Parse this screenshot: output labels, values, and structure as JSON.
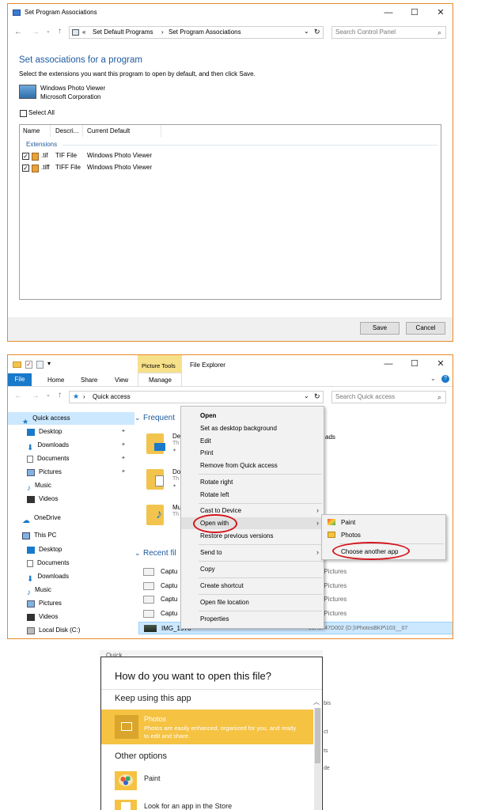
{
  "win1": {
    "title": "Set Program Associations",
    "breadcrumb_prefix": "«",
    "breadcrumb_1": "Set Default Programs",
    "breadcrumb_sep": "›",
    "breadcrumb_2": "Set Program Associations",
    "search_placeholder": "Search Control Panel",
    "heading": "Set associations for a program",
    "subtitle": "Select the extensions you want this program to open by default, and then click Save.",
    "program_name": "Windows Photo Viewer",
    "program_company": "Microsoft Corporation",
    "select_all": "Select All",
    "columns": [
      "Name",
      "Descri...",
      "Current Default"
    ],
    "group_label": "Extensions",
    "rows": [
      {
        "name": ".tif",
        "desc": "TIF File",
        "default": "Windows Photo Viewer"
      },
      {
        "name": ".tiff",
        "desc": "TIFF File",
        "default": "Windows Photo Viewer"
      }
    ],
    "save": "Save",
    "cancel": "Cancel"
  },
  "win2": {
    "picture_tools": "Picture Tools",
    "app_title": "File Explorer",
    "ribbon_tabs": [
      "File",
      "Home",
      "Share",
      "View",
      "Manage"
    ],
    "address": "Quick access",
    "search_placeholder": "Search Quick access",
    "sidebar": [
      "Quick access",
      "Desktop",
      "Downloads",
      "Documents",
      "Pictures",
      "Music",
      "Videos",
      "OneDrive",
      "This PC",
      "Desktop",
      "Documents",
      "Downloads",
      "Music",
      "Pictures",
      "Videos",
      "Local Disk (C:)"
    ],
    "frequent_header": "Frequent",
    "recent_header": "Recent fil",
    "folders": [
      {
        "name": "De",
        "sub": "Th"
      },
      {
        "name": "Do",
        "sub": "Th"
      },
      {
        "name": "Mu",
        "sub": "Th"
      }
    ],
    "recent_files": [
      "Captu",
      "Captu",
      "Captu",
      "Captu",
      "IMG_1976"
    ],
    "recent_paths": [
      "PC\\Pictures",
      "PC\\Pictures",
      "PC\\Pictures",
      "PC\\Pictures",
      "53A6747D002 (D:)\\PhotosBKP\\103__07"
    ],
    "frequent_extra": "ads",
    "context_menu": [
      "Open",
      "Set as desktop background",
      "Edit",
      "Print",
      "Remove from Quick access",
      "Rotate right",
      "Rotate left",
      "Cast to Device",
      "Open with",
      "Restore previous versions",
      "Send to",
      "Copy",
      "Create shortcut",
      "Open file location",
      "Properties"
    ],
    "submenu": [
      "Paint",
      "Photos",
      "Choose another app"
    ]
  },
  "dialog": {
    "top_cut": "Quick",
    "title": "How do you want to open this file?",
    "keep_using": "Keep using this app",
    "photos_name": "Photos",
    "photos_desc": "Photos are easily enhanced, organized for you, and ready to edit and share.",
    "other_options": "Other options",
    "paint": "Paint",
    "store": "Look for an app in the Store",
    "right_cuts": [
      "bis",
      "ct",
      "ts",
      "de"
    ]
  },
  "colors": {
    "accent_blue": "#1979ca",
    "heading_blue": "#1e5a9e",
    "photos_yellow": "#f5c242",
    "ring_red": "#d4141b",
    "picture_tools_bg": "#f7e08a",
    "selected_row": "#cce8ff"
  }
}
